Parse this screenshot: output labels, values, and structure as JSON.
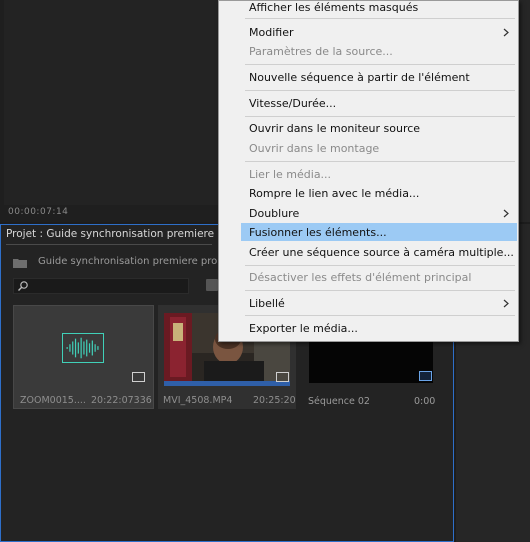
{
  "monitor": {
    "timecode": "00:00:07:14"
  },
  "project": {
    "tab_title": "Projet : Guide synchronisation premiere pro",
    "file_name": "Guide synchronisation premiere pro.prp",
    "search": {
      "placeholder": ""
    }
  },
  "clips": [
    {
      "name": "ZOOM0015....",
      "duration": "20:22:07336"
    },
    {
      "name": "MVI_4508.MP4",
      "duration": "20:25:20"
    },
    {
      "name": "Séquence 02",
      "duration": "0:00"
    }
  ],
  "context_menu": {
    "items": [
      {
        "label": "Afficher les éléments masqués"
      },
      {
        "label": "Modifier"
      },
      {
        "label": "Paramètres de la source..."
      },
      {
        "label": "Nouvelle séquence à partir de l'élément"
      },
      {
        "label": "Vitesse/Durée..."
      },
      {
        "label": "Ouvrir dans le moniteur source"
      },
      {
        "label": "Ouvrir dans le montage"
      },
      {
        "label": "Lier le média..."
      },
      {
        "label": "Rompre le lien avec le média..."
      },
      {
        "label": "Doublure"
      },
      {
        "label": "Fusionner les éléments..."
      },
      {
        "label": "Créer une séquence source à caméra multiple..."
      },
      {
        "label": "Désactiver les effets d'élément principal"
      },
      {
        "label": "Libellé"
      },
      {
        "label": "Exporter le média..."
      }
    ]
  },
  "colors": {
    "accent_border": "#2e6fc9",
    "menu_highlight": "#9ccaf4",
    "audio_wave": "#40d0b8"
  },
  "icons": [
    "folder-icon",
    "search-icon",
    "waveform-icon",
    "clip-type-badge-icon",
    "submenu-arrow-icon"
  ]
}
